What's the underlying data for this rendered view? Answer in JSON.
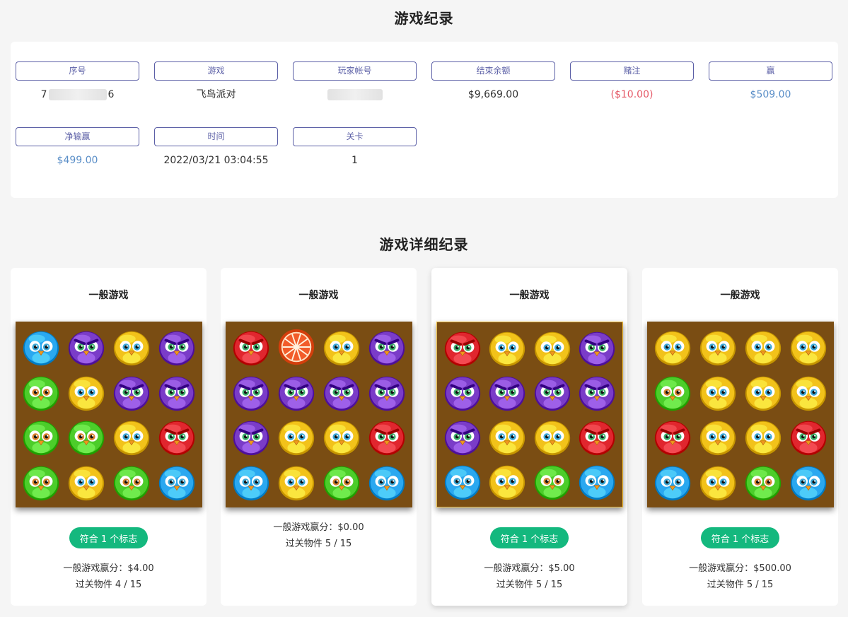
{
  "page_title": "游戏纪录",
  "summary": {
    "fields": [
      {
        "label": "序号",
        "value_left": "7",
        "value_right": "6",
        "tone": ""
      },
      {
        "label": "游戏",
        "value": "飞鸟派对",
        "tone": ""
      },
      {
        "label": "玩家帐号",
        "value": "",
        "tone": ""
      },
      {
        "label": "结束余额",
        "value": "$9,669.00",
        "tone": ""
      },
      {
        "label": "赌注",
        "value": "($10.00)",
        "tone": "red"
      },
      {
        "label": "赢",
        "value": "$509.00",
        "tone": "blue"
      },
      {
        "label": "净输赢",
        "value": "$499.00",
        "tone": "blue"
      },
      {
        "label": "时间",
        "value": "2022/03/21 03:04:55",
        "tone": ""
      },
      {
        "label": "关卡",
        "value": "1",
        "tone": ""
      }
    ]
  },
  "section_title": "游戏详细纪录",
  "colors": {
    "blue": "#2aa8f0",
    "purple": "#7a3cc8",
    "yellow": "#f2c21a",
    "green": "#4ccd2a",
    "red": "#e0262e",
    "orange": "#f25c2a",
    "board": "#7a4d13",
    "accent_green": "#14b87e"
  },
  "cards": [
    {
      "title": "一般游戏",
      "highlight": false,
      "elevated": false,
      "match_label": "符合 1 个标志",
      "score": "一般游戏赢分：$4.00",
      "objects": "过关物件 4 / 15",
      "grid": [
        [
          "blue",
          "purple",
          "yellow",
          "purple"
        ],
        [
          "green",
          "yellow",
          "purple",
          "purple"
        ],
        [
          "green",
          "green",
          "yellow",
          "red"
        ],
        [
          "green",
          "yellow",
          "green",
          "blue"
        ]
      ]
    },
    {
      "title": "一般游戏",
      "highlight": false,
      "elevated": false,
      "match_label": "",
      "score": "一般游戏赢分：$0.00",
      "objects": "过关物件 5 / 15",
      "grid": [
        [
          "red",
          "orange",
          "yellow",
          "purple"
        ],
        [
          "purple",
          "purple",
          "purple",
          "purple"
        ],
        [
          "purple",
          "yellow",
          "yellow",
          "red"
        ],
        [
          "blue",
          "yellow",
          "green",
          "blue"
        ]
      ]
    },
    {
      "title": "一般游戏",
      "highlight": true,
      "elevated": true,
      "match_label": "符合 1 个标志",
      "score": "一般游戏赢分：$5.00",
      "objects": "过关物件 5 / 15",
      "grid": [
        [
          "red",
          "yellow",
          "yellow",
          "purple"
        ],
        [
          "purple",
          "purple",
          "purple",
          "purple"
        ],
        [
          "purple",
          "yellow",
          "yellow",
          "red"
        ],
        [
          "blue",
          "yellow",
          "green",
          "blue"
        ]
      ]
    },
    {
      "title": "一般游戏",
      "highlight": false,
      "elevated": false,
      "match_label": "符合 1 个标志",
      "score": "一般游戏赢分：$500.00",
      "objects": "过关物件 5 / 15",
      "grid": [
        [
          "yellow",
          "yellow",
          "yellow",
          "yellow"
        ],
        [
          "green",
          "yellow",
          "yellow",
          "yellow"
        ],
        [
          "red",
          "yellow",
          "yellow",
          "red"
        ],
        [
          "blue",
          "yellow",
          "green",
          "blue"
        ]
      ]
    }
  ]
}
